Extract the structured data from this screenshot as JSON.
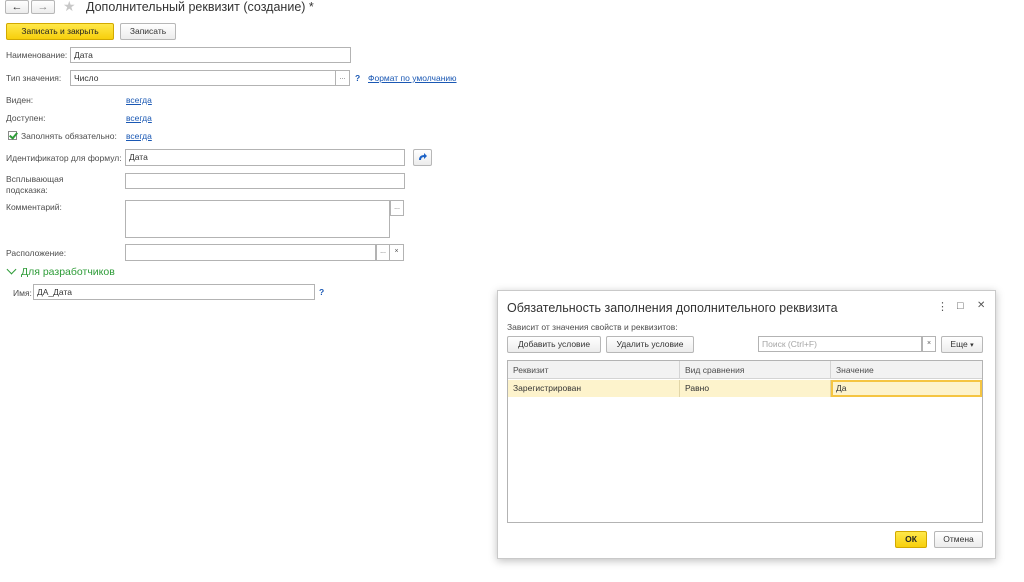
{
  "window": {
    "title": "Дополнительный реквизит (создание) *",
    "nav_back": "←",
    "nav_forward": "→",
    "favorite_star": "★"
  },
  "toolbar": {
    "save_close_label": "Записать и закрыть",
    "save_label": "Записать"
  },
  "form": {
    "name_label": "Наименование:",
    "name_value": "Дата",
    "type_label": "Тип значения:",
    "type_value": "Число",
    "format_link": "Формат по умолчанию",
    "visible_label": "Виден:",
    "visible_value": "всегда",
    "available_label": "Доступен:",
    "available_value": "всегда",
    "required_label": "Заполнять обязательно:",
    "required_value": "всегда",
    "formula_id_label": "Идентификатор для формул:",
    "formula_id_value": "Дата",
    "tooltip_label": "Всплывающая подсказка:",
    "tooltip_value": "",
    "comment_label": "Комментарий:",
    "comment_value": "",
    "location_label": "Расположение:",
    "location_value": "",
    "dev_section": "Для разработчиков",
    "dev_name_label": "Имя:",
    "dev_name_value": "ДА_Дата"
  },
  "symbols": {
    "dots": "...",
    "question": "?",
    "clear": "×",
    "chevron": "▾",
    "kebab": "⋮",
    "maximize": "□",
    "close": "✕"
  },
  "dialog": {
    "title": "Обязательность заполнения дополнительного реквизита",
    "subtitle": "Зависит от значения свойств и реквизитов:",
    "add_condition": "Добавить условие",
    "remove_condition": "Удалить условие",
    "search_placeholder": "Поиск (Ctrl+F)",
    "more_label": "Еще",
    "columns": [
      "Реквизит",
      "Вид сравнения",
      "Значение"
    ],
    "rows": [
      [
        "Зарегистрирован",
        "Равно",
        "Да"
      ]
    ],
    "ok_label": "ОК",
    "cancel_label": "Отмена"
  },
  "colors": {
    "accent_yellow": "#f7cf0c",
    "link_blue": "#1a58b4",
    "section_green": "#2e9c38",
    "row_highlight": "#fdf3cc"
  }
}
